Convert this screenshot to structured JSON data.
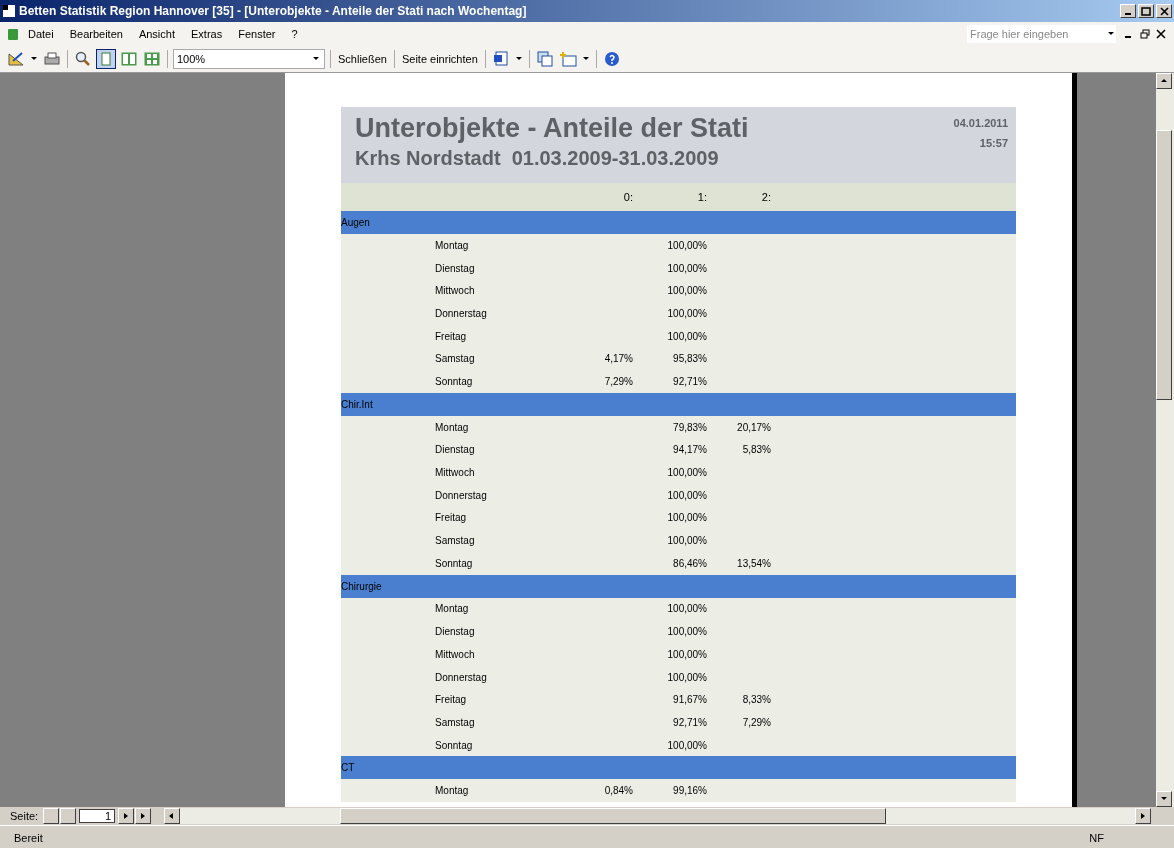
{
  "window": {
    "title": "Betten Statistik Region Hannover [35] - [Unterobjekte - Anteile der Stati nach Wochentag]"
  },
  "menu": [
    "Datei",
    "Bearbeiten",
    "Ansicht",
    "Extras",
    "Fenster",
    "?"
  ],
  "help_search": {
    "placeholder": "Frage hier eingeben"
  },
  "toolbar": {
    "zoom": "100%",
    "close_button": "Schließen",
    "page_setup_button": "Seite einrichten"
  },
  "report": {
    "title": "Unterobjekte - Anteile der Stati",
    "subtitle": "Krhs Nordstadt  01.03.2009-31.03.2009",
    "date": "04.01.2011",
    "time": "15:57",
    "columns": [
      "0:",
      "1:",
      "2:"
    ],
    "groups": [
      {
        "name": "Augen",
        "rows": [
          {
            "day": "Montag",
            "share_1": "100,00%"
          },
          {
            "day": "Dienstag",
            "share_1": "100,00%"
          },
          {
            "day": "Mittwoch",
            "share_1": "100,00%"
          },
          {
            "day": "Donnerstag",
            "share_1": "100,00%"
          },
          {
            "day": "Freitag",
            "share_1": "100,00%"
          },
          {
            "day": "Samstag",
            "share_0": "4,17%",
            "share_1": "95,83%"
          },
          {
            "day": "Sonntag",
            "share_0": "7,29%",
            "share_1": "92,71%"
          }
        ]
      },
      {
        "name": "Chir.Int",
        "rows": [
          {
            "day": "Montag",
            "share_1": "79,83%",
            "share_2": "20,17%"
          },
          {
            "day": "Dienstag",
            "share_1": "94,17%",
            "share_2": "5,83%"
          },
          {
            "day": "Mittwoch",
            "share_1": "100,00%"
          },
          {
            "day": "Donnerstag",
            "share_1": "100,00%"
          },
          {
            "day": "Freitag",
            "share_1": "100,00%"
          },
          {
            "day": "Samstag",
            "share_1": "100,00%"
          },
          {
            "day": "Sonntag",
            "share_1": "86,46%",
            "share_2": "13,54%"
          }
        ]
      },
      {
        "name": "Chirurgie",
        "rows": [
          {
            "day": "Montag",
            "share_1": "100,00%"
          },
          {
            "day": "Dienstag",
            "share_1": "100,00%"
          },
          {
            "day": "Mittwoch",
            "share_1": "100,00%"
          },
          {
            "day": "Donnerstag",
            "share_1": "100,00%"
          },
          {
            "day": "Freitag",
            "share_1": "91,67%",
            "share_2": "8,33%"
          },
          {
            "day": "Samstag",
            "share_1": "92,71%",
            "share_2": "7,29%"
          },
          {
            "day": "Sonntag",
            "share_1": "100,00%"
          }
        ]
      },
      {
        "name": "CT",
        "rows": [
          {
            "day": "Montag",
            "share_0": "0,84%",
            "share_1": "99,16%"
          }
        ]
      }
    ]
  },
  "navigation": {
    "label": "Seite:",
    "page": "1"
  },
  "status_bar": {
    "text": "Bereit",
    "indicator": "NF"
  }
}
